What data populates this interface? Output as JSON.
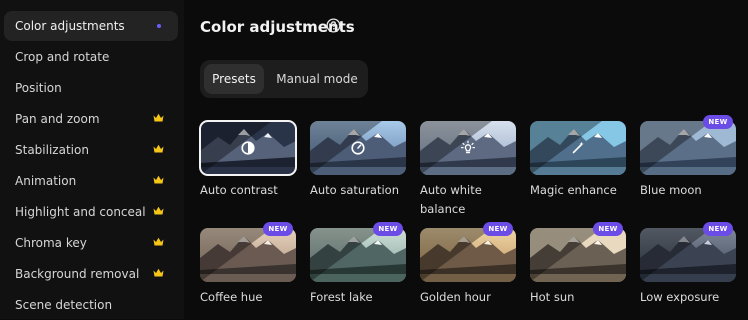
{
  "sidebar": {
    "items": [
      {
        "label": "Color adjustments",
        "active": true,
        "premium": false
      },
      {
        "label": "Crop and rotate",
        "active": false,
        "premium": false
      },
      {
        "label": "Position",
        "active": false,
        "premium": false
      },
      {
        "label": "Pan and zoom",
        "active": false,
        "premium": true
      },
      {
        "label": "Stabilization",
        "active": false,
        "premium": true
      },
      {
        "label": "Animation",
        "active": false,
        "premium": true
      },
      {
        "label": "Highlight and conceal",
        "active": false,
        "premium": true
      },
      {
        "label": "Chroma key",
        "active": false,
        "premium": true
      },
      {
        "label": "Background removal",
        "active": false,
        "premium": true
      },
      {
        "label": "Scene detection",
        "active": false,
        "premium": false
      }
    ]
  },
  "main": {
    "title": "Color adjustments",
    "tabs": [
      {
        "label": "Presets",
        "selected": true
      },
      {
        "label": "Manual mode",
        "selected": false
      }
    ],
    "badge_text": "NEW",
    "presets": [
      {
        "label": "Auto contrast",
        "icon": "contrast-icon",
        "new": false,
        "selected": true
      },
      {
        "label": "Auto saturation",
        "icon": "saturation-gauge-icon",
        "new": false,
        "selected": false
      },
      {
        "label": "Auto white balance",
        "icon": "lightbulb-icon",
        "new": false,
        "selected": false
      },
      {
        "label": "Magic enhance",
        "icon": "magic-wand-icon",
        "new": false,
        "selected": false
      },
      {
        "label": "Blue moon",
        "icon": "",
        "new": true,
        "selected": false
      },
      {
        "label": "Coffee hue",
        "icon": "",
        "new": true,
        "selected": false
      },
      {
        "label": "Forest lake",
        "icon": "",
        "new": true,
        "selected": false
      },
      {
        "label": "Golden hour",
        "icon": "",
        "new": true,
        "selected": false
      },
      {
        "label": "Hot sun",
        "icon": "",
        "new": true,
        "selected": false
      },
      {
        "label": "Low exposure",
        "icon": "",
        "new": true,
        "selected": false
      }
    ]
  },
  "colors": {
    "accent": "#6b4ce6",
    "premium_crown": "#f5c518",
    "active_dot": "#6b5cff"
  }
}
